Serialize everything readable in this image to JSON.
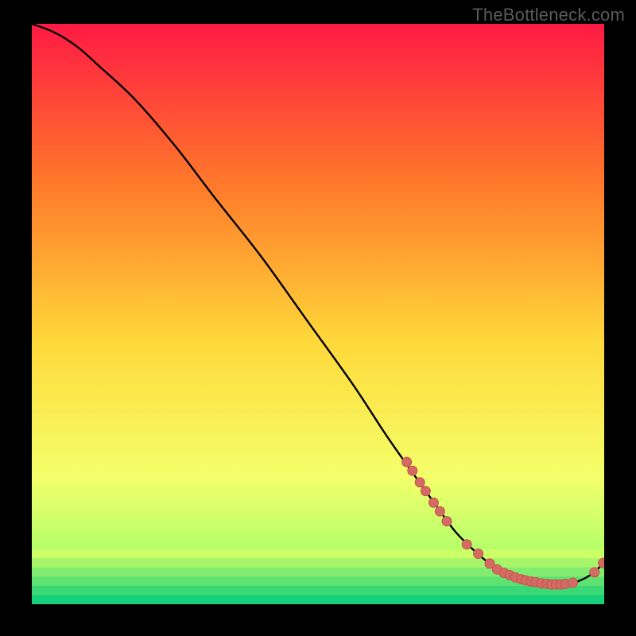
{
  "watermark": "TheBottleneck.com",
  "colors": {
    "background": "#000000",
    "gradient_top": "#ff1a44",
    "gradient_mid1": "#ff7a2a",
    "gradient_mid2": "#ffd93a",
    "gradient_low": "#f4ff6a",
    "gradient_green_start": "#b8ff6a",
    "gradient_bottom": "#18e07a",
    "curve": "#000000",
    "marker_fill": "#d46a63",
    "marker_stroke": "#c2574f"
  },
  "chart_data": {
    "type": "line",
    "title": "",
    "xlabel": "",
    "ylabel": "",
    "xlim": [
      0,
      100
    ],
    "ylim": [
      0,
      100
    ],
    "series": [
      {
        "name": "bottleneck-curve",
        "x": [
          0,
          4,
          8,
          12,
          18,
          25,
          32,
          40,
          48,
          56,
          62,
          67,
          71,
          74,
          77,
          80,
          83,
          86,
          89,
          92,
          95,
          98,
          100
        ],
        "y": [
          100,
          98.5,
          96,
          92.5,
          87,
          79,
          70,
          60,
          49,
          38,
          29,
          22,
          16.5,
          12.5,
          9.5,
          7,
          5.3,
          4.2,
          3.6,
          3.4,
          3.8,
          5.3,
          7.3
        ]
      }
    ],
    "markers": [
      {
        "x": 65.5,
        "y": 24.5
      },
      {
        "x": 66.5,
        "y": 23.0
      },
      {
        "x": 67.8,
        "y": 21.0
      },
      {
        "x": 68.8,
        "y": 19.5
      },
      {
        "x": 70.2,
        "y": 17.5
      },
      {
        "x": 71.3,
        "y": 16.0
      },
      {
        "x": 72.5,
        "y": 14.3
      },
      {
        "x": 76.0,
        "y": 10.3
      },
      {
        "x": 78.0,
        "y": 8.7
      },
      {
        "x": 80.0,
        "y": 7.0
      },
      {
        "x": 81.3,
        "y": 6.0
      },
      {
        "x": 82.5,
        "y": 5.4
      },
      {
        "x": 83.5,
        "y": 5.0
      },
      {
        "x": 84.5,
        "y": 4.6
      },
      {
        "x": 85.5,
        "y": 4.3
      },
      {
        "x": 86.3,
        "y": 4.1
      },
      {
        "x": 87.2,
        "y": 3.9
      },
      {
        "x": 88.0,
        "y": 3.8
      },
      {
        "x": 89.0,
        "y": 3.6
      },
      {
        "x": 90.0,
        "y": 3.5
      },
      {
        "x": 90.8,
        "y": 3.4
      },
      {
        "x": 91.6,
        "y": 3.4
      },
      {
        "x": 92.4,
        "y": 3.4
      },
      {
        "x": 93.2,
        "y": 3.5
      },
      {
        "x": 94.5,
        "y": 3.7
      },
      {
        "x": 98.3,
        "y": 5.5
      },
      {
        "x": 99.8,
        "y": 7.1
      }
    ]
  }
}
